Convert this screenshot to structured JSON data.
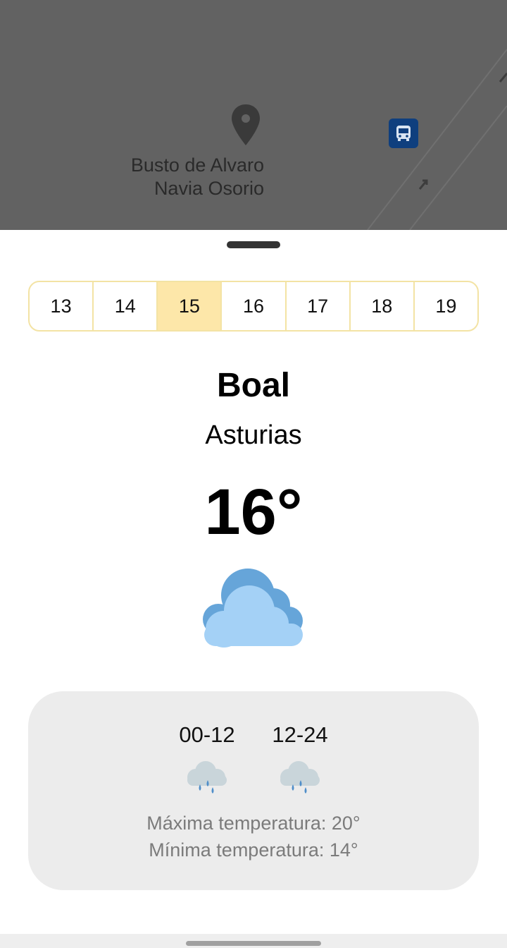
{
  "map": {
    "place_line1": "Busto de Alvaro",
    "place_line2": "Navia Osorio",
    "pin_icon": "map-pin-icon",
    "bus_icon": "bus-icon"
  },
  "days": [
    "13",
    "14",
    "15",
    "16",
    "17",
    "18",
    "19"
  ],
  "selected_day": "15",
  "location": {
    "name": "Boal",
    "region": "Asturias"
  },
  "current": {
    "temperature": "16°",
    "icon": "cloudy-icon"
  },
  "forecast": {
    "periods": [
      {
        "label": "00-12",
        "icon": "rain-cloud-icon"
      },
      {
        "label": "12-24",
        "icon": "rain-cloud-icon"
      }
    ],
    "max_temp": "Máxima temperatura: 20°",
    "min_temp": "Mínima temperatura: 14°"
  },
  "colors": {
    "map_background": "#626262",
    "selected_day": "#fde7a9",
    "day_border": "#f3e3a4",
    "card_background": "#ececec",
    "cloud_dark": "#66a5d9",
    "cloud_light": "#a4d1f6",
    "bus_stop": "#0f3f7e"
  }
}
